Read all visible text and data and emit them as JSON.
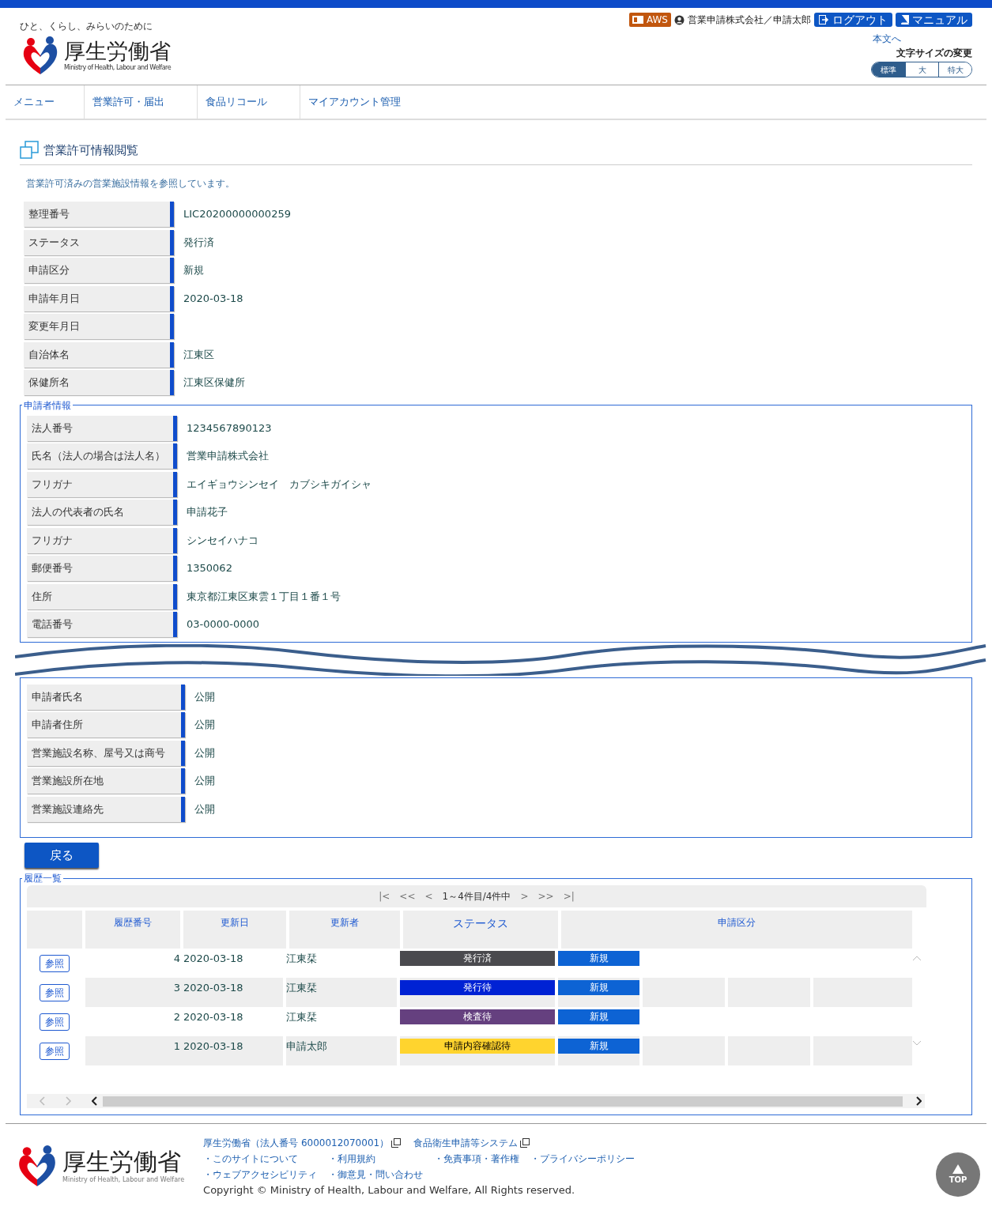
{
  "header": {
    "tagline": "ひと、くらし、みらいのために",
    "logo_name": "厚生労働省",
    "logo_sub": "Ministry of Health, Labour and Welfare",
    "env_badge": "AWS",
    "user": "営業申請株式会社／申請太郎",
    "logout": "ログアウト",
    "manual": "マニュアル",
    "skip_link": "本文へ",
    "font_size_label": "文字サイズの変更",
    "font_sizes": [
      {
        "label": "標準",
        "selected": true
      },
      {
        "label": "大",
        "selected": false
      },
      {
        "label": "特大",
        "selected": false
      }
    ]
  },
  "nav": [
    "メニュー",
    "営業許可・届出",
    "食品リコール",
    "マイアカウント管理"
  ],
  "page": {
    "title": "営業許可情報閲覧",
    "description": "営業許可済みの営業施設情報を参照しています。"
  },
  "basic_fields": [
    {
      "label": "整理番号",
      "value": "LIC20200000000259"
    },
    {
      "label": "ステータス",
      "value": "発行済"
    },
    {
      "label": "申請区分",
      "value": "新規"
    },
    {
      "label": "申請年月日",
      "value": "2020-03-18"
    },
    {
      "label": "変更年月日"
    },
    {
      "label": "自治体名",
      "value": "江東区"
    },
    {
      "label": "保健所名",
      "value": "江東区保健所"
    }
  ],
  "applicant": {
    "legend": "申請者情報",
    "fields": [
      {
        "label": "法人番号",
        "value": "1234567890123"
      },
      {
        "label": "氏名（法人の場合は法人名）",
        "value": "営業申請株式会社"
      },
      {
        "label": "フリガナ",
        "value": "エイギョウシンセイ　カブシキガイシャ"
      },
      {
        "label": "法人の代表者の氏名",
        "value": "申請花子"
      },
      {
        "label": "フリガナ",
        "value": "シンセイハナコ"
      },
      {
        "label": "郵便番号",
        "value": "1350062"
      },
      {
        "label": "住所",
        "value": "東京都江東区東雲１丁目１番１号"
      },
      {
        "label": "電話番号",
        "value": "03-0000-0000"
      }
    ]
  },
  "disclosure": {
    "fields": [
      {
        "label": "申請者氏名",
        "value": "公開"
      },
      {
        "label": "申請者住所",
        "value": "公開"
      },
      {
        "label": "営業施設名称、屋号又は商号",
        "value": "公開"
      },
      {
        "label": "営業施設所在地",
        "value": "公開"
      },
      {
        "label": "営業施設連絡先",
        "value": "公開"
      }
    ]
  },
  "back_button": "戻る",
  "history": {
    "legend": "履歴一覧",
    "pager": {
      "first": "|<",
      "prev_page": "<<",
      "prev": "<",
      "summary": "1～4件目/4件中",
      "next": ">",
      "next_page": ">>",
      "last": ">|"
    },
    "columns": [
      "履歴番号",
      "更新日",
      "更新者",
      "ステータス",
      "申請区分"
    ],
    "rows": [
      {
        "view_label": "参照",
        "number": "4",
        "date": "2020-03-18",
        "updater": "江東栞",
        "status": "発行済",
        "color": "#4a4a4e",
        "type": "新規"
      },
      {
        "view_label": "参照",
        "number": "3",
        "date": "2020-03-18",
        "updater": "江東栞",
        "status": "発行待",
        "color": "#0022d4",
        "type": "新規"
      },
      {
        "view_label": "参照",
        "number": "2",
        "date": "2020-03-18",
        "updater": "江東栞",
        "status": "検査待",
        "color": "#65407f",
        "type": "新規"
      },
      {
        "view_label": "参照",
        "number": "1",
        "date": "2020-03-18",
        "updater": "申請太郎",
        "status": "申請内容確認待",
        "color": "#ffd42e",
        "type": "新規"
      }
    ]
  },
  "footer": {
    "logo_name": "厚生労働省",
    "logo_sub": "Ministry of Health, Labour and Welfare",
    "org": "厚生労働省（法人番号 6000012070001）",
    "system": "食品衛生申請等システム",
    "links": [
      "・このサイトについて",
      "・利用規約",
      "・免責事項・著作権",
      "・プライバシーポリシー",
      "・ウェブアクセシビリティ",
      "・御意見・問い合わせ"
    ],
    "copyright": "Copyright © Ministry of Health, Labour and Welfare, All Rights reserved.",
    "top": "TOP"
  }
}
